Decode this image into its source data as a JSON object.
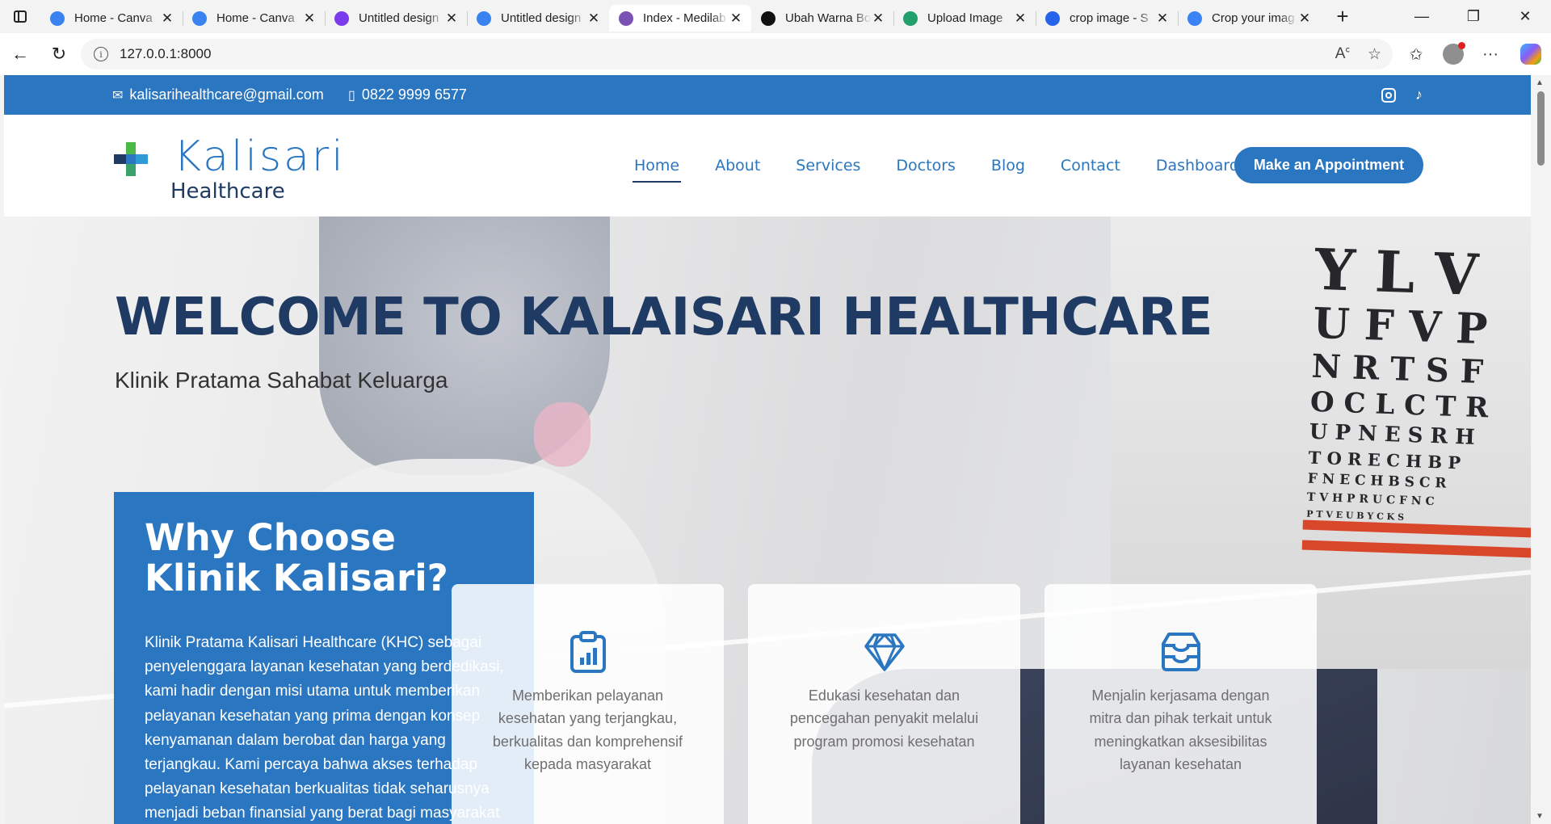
{
  "browser": {
    "tabs": [
      {
        "title": "Home - Canva",
        "favicon": "canva-icon",
        "color": "#3a82f0",
        "active": false
      },
      {
        "title": "Home - Canva",
        "favicon": "canva-icon",
        "color": "#3a82f0",
        "active": false
      },
      {
        "title": "Untitled design",
        "favicon": "canva-badge-icon",
        "color": "#7c3aed",
        "active": false
      },
      {
        "title": "Untitled design",
        "favicon": "canva-icon",
        "color": "#3a82f0",
        "active": false
      },
      {
        "title": "Index - Medilab",
        "favicon": "bootstrap-icon",
        "color": "#7952b3",
        "active": true
      },
      {
        "title": "Ubah Warna Bo",
        "favicon": "openai-icon",
        "color": "#111111",
        "active": false
      },
      {
        "title": "Upload Image",
        "favicon": "image-upload-icon",
        "color": "#22a06b",
        "active": false
      },
      {
        "title": "crop image - S",
        "favicon": "search-icon",
        "color": "#2563eb",
        "active": false
      },
      {
        "title": "Crop your imag",
        "favicon": "heart-icon",
        "color": "#3b82f6",
        "active": false
      }
    ],
    "url": "127.0.0.1:8000",
    "new_tab_glyph": "+",
    "window_controls": {
      "minimize": "—",
      "restore": "❐",
      "close": "✕"
    }
  },
  "site": {
    "topbar": {
      "email": "kalisarihealthcare@gmail.com",
      "phone": "0822 9999 6577",
      "social": [
        "instagram-icon",
        "tiktok-icon"
      ]
    },
    "logo": {
      "name": "Kalisari",
      "sub": "Healthcare"
    },
    "nav": {
      "items": [
        "Home",
        "About",
        "Services",
        "Doctors",
        "Blog",
        "Contact",
        "Dashboard"
      ],
      "active": "Home",
      "cta": "Make an Appointment"
    },
    "hero": {
      "title": "WELCOME TO KALAISARI HEALTHCARE",
      "subtitle": "Klinik Pratama Sahabat Keluarga"
    },
    "why": {
      "title": "Why Choose Klinik Kalisari?",
      "body": "Klinik Pratama Kalisari Healthcare (KHC) sebagai penyelenggara layanan kesehatan yang berdedikasi, kami hadir dengan misi utama untuk memberikan pelayanan kesehatan yang prima dengan konsep kenyamanan dalam berobat dan harga yang terjangkau. Kami percaya bahwa akses terhadap pelayanan kesehatan berkualitas tidak seharusnya menjadi beban finansial yang berat bagi masyarakat"
    },
    "cards": [
      {
        "icon": "clipboard-chart-icon",
        "text": "Memberikan pelayanan kesehatan yang terjangkau, berkualitas dan komprehensif kepada masyarakat"
      },
      {
        "icon": "diamond-icon",
        "text": "Edukasi kesehatan dan pencegahan penyakit melalui program promosi kesehatan"
      },
      {
        "icon": "inbox-icon",
        "text": "Menjalin kerjasama dengan mitra dan pihak terkait untuk meningkatkan aksesibilitas layanan kesehatan"
      }
    ],
    "eye_chart_rows": [
      "Y L V",
      "U F V P",
      "N R T S F",
      "O C L C T R",
      "U P N E S R H",
      "T O R E C H B P",
      "F N E C H B S C R",
      "T V H P R U C F N C",
      "P T V E U B Y C K S"
    ],
    "colors": {
      "primary": "#2a76c0",
      "dark": "#1f3b63"
    }
  }
}
